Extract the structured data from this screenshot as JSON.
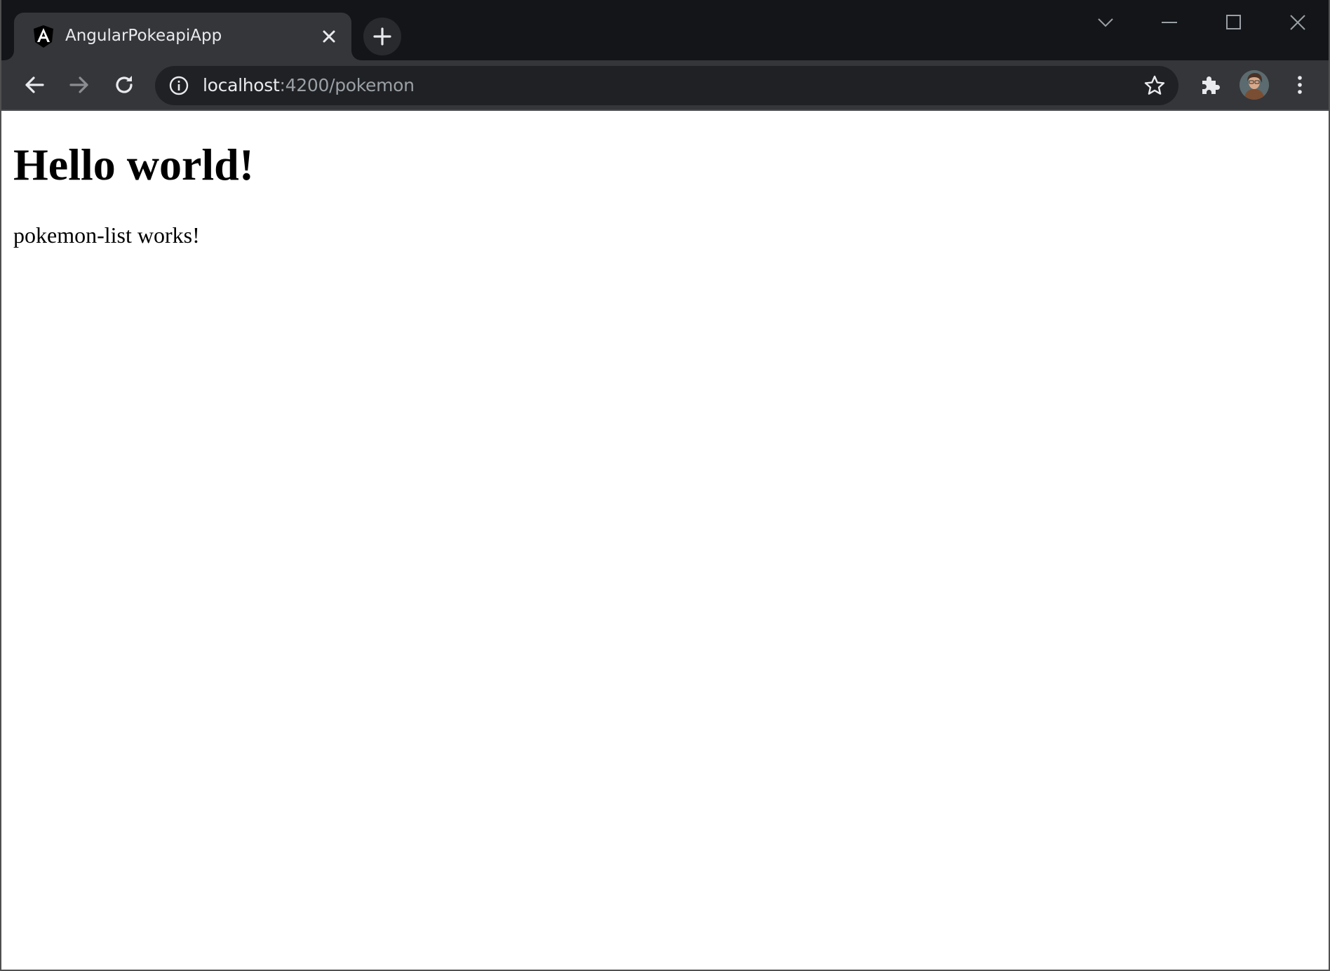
{
  "browser": {
    "tab": {
      "title": "AngularPokeapiApp",
      "favicon": "angular-logo-icon"
    },
    "address_bar": {
      "host": "localhost",
      "path": ":4200/pokemon"
    },
    "icons": {
      "back": "arrow-left-icon",
      "forward": "arrow-right-icon",
      "reload": "reload-icon",
      "site_info": "info-icon",
      "bookmark": "star-icon",
      "extensions": "puzzle-icon",
      "menu": "kebab-menu-icon",
      "tab_search": "chevron-down-icon",
      "minimize": "minimize-icon",
      "maximize": "maximize-icon",
      "close": "close-icon",
      "new_tab": "plus-icon"
    },
    "colors": {
      "tabstrip_bg": "#141518",
      "toolbar_bg": "#35363a",
      "omnibox_bg": "#202124",
      "text_primary": "#e8eaed",
      "text_secondary": "#9aa0a6"
    }
  },
  "page": {
    "heading": "Hello world!",
    "body_text": "pokemon-list works!"
  }
}
